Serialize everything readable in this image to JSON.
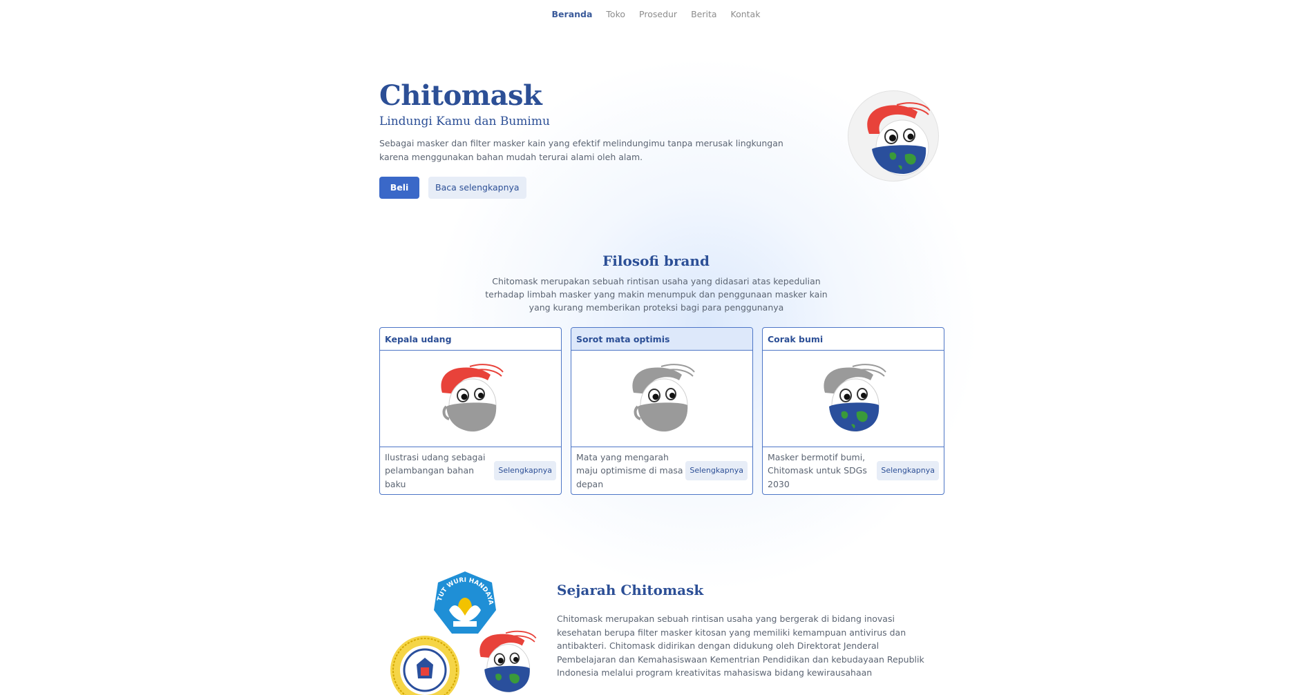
{
  "nav": {
    "items": [
      {
        "label": "Beranda",
        "active": true
      },
      {
        "label": "Toko",
        "active": false
      },
      {
        "label": "Prosedur",
        "active": false
      },
      {
        "label": "Berita",
        "active": false
      },
      {
        "label": "Kontak",
        "active": false
      }
    ]
  },
  "hero": {
    "title": "Chitomask",
    "subtitle": "Lindungi Kamu dan Bumimu",
    "description": "Sebagai masker dan filter masker kain yang efektif melindungimu tanpa merusak lingkungan karena menggunakan bahan mudah terurai alami oleh alam.",
    "buy_label": "Beli",
    "read_more_label": "Baca selengkapnya"
  },
  "filosofi": {
    "title": "Filosofi brand",
    "description": "Chitomask merupakan sebuah rintisan usaha yang didasari atas kepedulian terhadap limbah masker yang makin menumpuk dan penggunaan masker kain yang kurang memberikan proteksi bagi para penggunanya",
    "cards": [
      {
        "title": "Kepala udang",
        "text": "Ilustrasi udang sebagai pelambangan bahan baku",
        "button": "Selengkapnya"
      },
      {
        "title": "Sorot mata optimis",
        "text": "Mata yang mengarah maju optimisme di masa depan",
        "button": "Selengkapnya"
      },
      {
        "title": "Corak bumi",
        "text": "Masker bermotif bumi, Chitomask untuk SDGs 2030",
        "button": "Selengkapnya"
      }
    ]
  },
  "sejarah": {
    "title": "Sejarah Chitomask",
    "description": "Chitomask merupakan sebuah rintisan usaha yang bergerak di bidang inovasi kesehatan berupa filter masker kitosan yang memiliki kemampuan antivirus dan antibakteri. Chitomask didirikan dengan didukung oleh Direktorat Jenderal Pembelajaran dan Kemahasiswaan Kementrian Pendidikan dan kebudayaan Republik Indonesia melalui program kreativitas mahasiswa bidang kewirausahaan",
    "logo_text": "TUT WURI HANDAYANI"
  },
  "colors": {
    "primary": "#2c4f96",
    "button": "#3a68c8",
    "shrimp_red": "#e8423a",
    "earth_blue": "#2a4f9c",
    "land_green": "#3a9a3a"
  }
}
